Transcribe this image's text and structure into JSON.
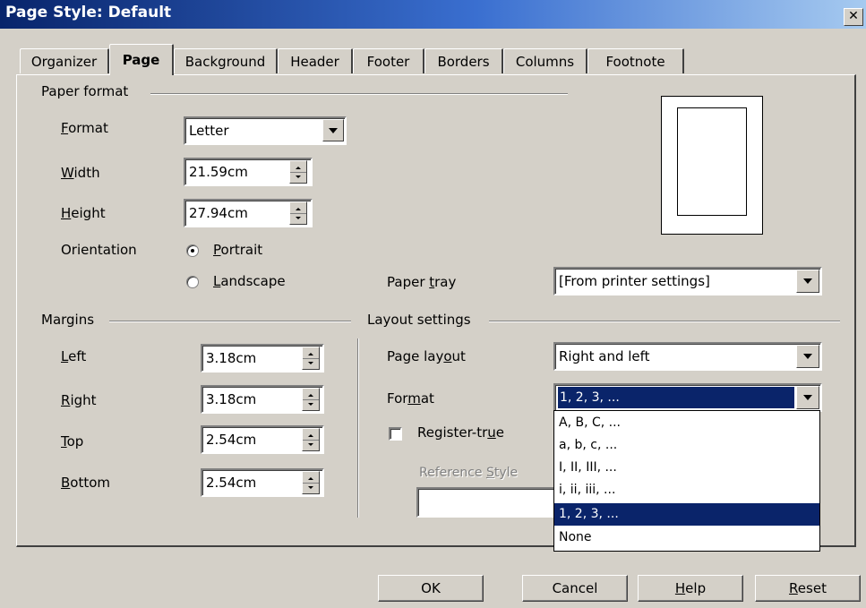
{
  "window": {
    "title": "Page Style: Default",
    "close_glyph": "✕"
  },
  "tabs": [
    {
      "label": "Organizer",
      "active": false
    },
    {
      "label": "Page",
      "active": true
    },
    {
      "label": "Background",
      "active": false
    },
    {
      "label": "Header",
      "active": false
    },
    {
      "label": "Footer",
      "active": false
    },
    {
      "label": "Borders",
      "active": false
    },
    {
      "label": "Columns",
      "active": false
    },
    {
      "label": "Footnote",
      "active": false
    }
  ],
  "paper_format": {
    "section_label": "Paper format",
    "format": {
      "label_mnemonic": "F",
      "label_rest": "ormat",
      "value": "Letter"
    },
    "width": {
      "label_mnemonic": "W",
      "label_rest": "idth",
      "value": "21.59cm"
    },
    "height": {
      "label_mnemonic": "H",
      "label_rest": "eight",
      "value": "27.94cm"
    },
    "orientation": {
      "label": "Orientation",
      "portrait": {
        "label_mnemonic": "P",
        "label_rest": "ortrait",
        "selected": true
      },
      "landscape": {
        "label_mnemonic": "L",
        "label_rest": "andscape",
        "selected": false
      }
    },
    "paper_tray": {
      "label_pre": "Paper ",
      "label_mnemonic": "t",
      "label_rest": "ray",
      "value": "[From printer settings]"
    }
  },
  "margins": {
    "section_label": "Margins",
    "left": {
      "label_mnemonic": "L",
      "label_rest": "eft",
      "value": "3.18cm"
    },
    "right": {
      "label_mnemonic": "R",
      "label_rest": "ight",
      "value": "3.18cm"
    },
    "top": {
      "label_mnemonic": "T",
      "label_rest": "op",
      "value": "2.54cm"
    },
    "bottom": {
      "label_mnemonic": "B",
      "label_rest": "ottom",
      "value": "2.54cm"
    }
  },
  "layout_settings": {
    "section_label": "Layout settings",
    "page_layout": {
      "label_pre": "Page lay",
      "label_mnemonic": "o",
      "label_rest": "ut",
      "value": "Right and left"
    },
    "format": {
      "label_pre": "For",
      "label_mnemonic": "m",
      "label_rest": "at",
      "value": "1, 2, 3, ..."
    },
    "register_true": {
      "label_pre": "Register-tr",
      "label_mnemonic": "u",
      "label_rest": "e",
      "checked": false
    },
    "reference_style": {
      "label_pre": "Reference ",
      "label_mnemonic": "S",
      "label_rest": "tyle"
    },
    "format_options": [
      "A, B, C, ...",
      "a, b, c, ...",
      "I, II, III, ...",
      "i, ii, iii, ...",
      "1, 2, 3, ...",
      "None"
    ],
    "format_selected_index": 4
  },
  "buttons": {
    "ok": "OK",
    "cancel": "Cancel",
    "help_mnemonic": "H",
    "help_rest": "elp",
    "reset_mnemonic": "R",
    "reset_rest": "eset"
  },
  "colors": {
    "titlebar": "#0a246a",
    "dialog_bg": "#d4d0c8",
    "selection": "#0a246a"
  }
}
